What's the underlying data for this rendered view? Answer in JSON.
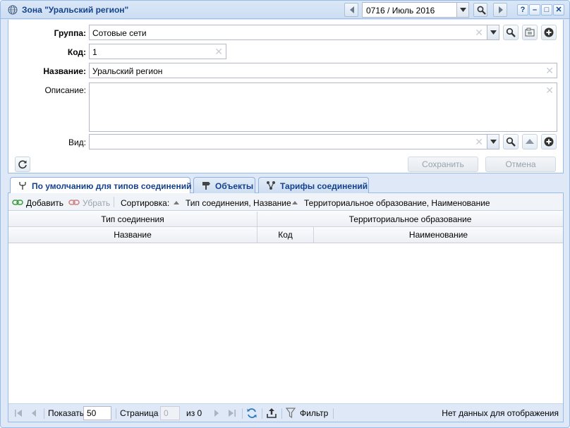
{
  "window": {
    "title": "Зона \"Уральский регион\""
  },
  "period": {
    "value": "0716 / Июль 2016"
  },
  "title_buttons": {
    "help": "?",
    "minimize": "–",
    "maximize": "□",
    "close": "✕"
  },
  "form": {
    "group_label": "Группа:",
    "group_value": "Сотовые сети",
    "code_label": "Код:",
    "code_value": "1",
    "name_label": "Название:",
    "name_value": "Уральский регион",
    "description_label": "Описание:",
    "description_value": "",
    "kind_label": "Вид:",
    "kind_value": "",
    "save_label": "Сохранить",
    "cancel_label": "Отмена"
  },
  "tabs": [
    {
      "label": "По умолчанию для типов соединений",
      "active": true
    },
    {
      "label": "Объекты",
      "active": false
    },
    {
      "label": "Тарифы соединений",
      "active": false
    }
  ],
  "toolbar": {
    "add_label": "Добавить",
    "remove_label": "Убрать",
    "sort_label": "Сортировка:",
    "sort1_label": "Тип соединения, Название",
    "sort2_label": "Территориальное образование, Наименование"
  },
  "grid": {
    "group_headers": [
      "Тип соединения",
      "Территориальное образование"
    ],
    "columns": [
      "Название",
      "Код",
      "Наименование"
    ],
    "rows": []
  },
  "pager": {
    "show_label": "Показать",
    "page_size": "50",
    "page_label": "Страница",
    "page_value": "0",
    "of_label": "из 0",
    "filter_label": "Фильтр",
    "status": "Нет данных для отображения"
  },
  "colors": {
    "accent": "#15428b",
    "frame": "#99bbe8",
    "background": "#dfe8f6",
    "add_icon": "#3a9a3a",
    "remove_icon": "#d08080"
  }
}
